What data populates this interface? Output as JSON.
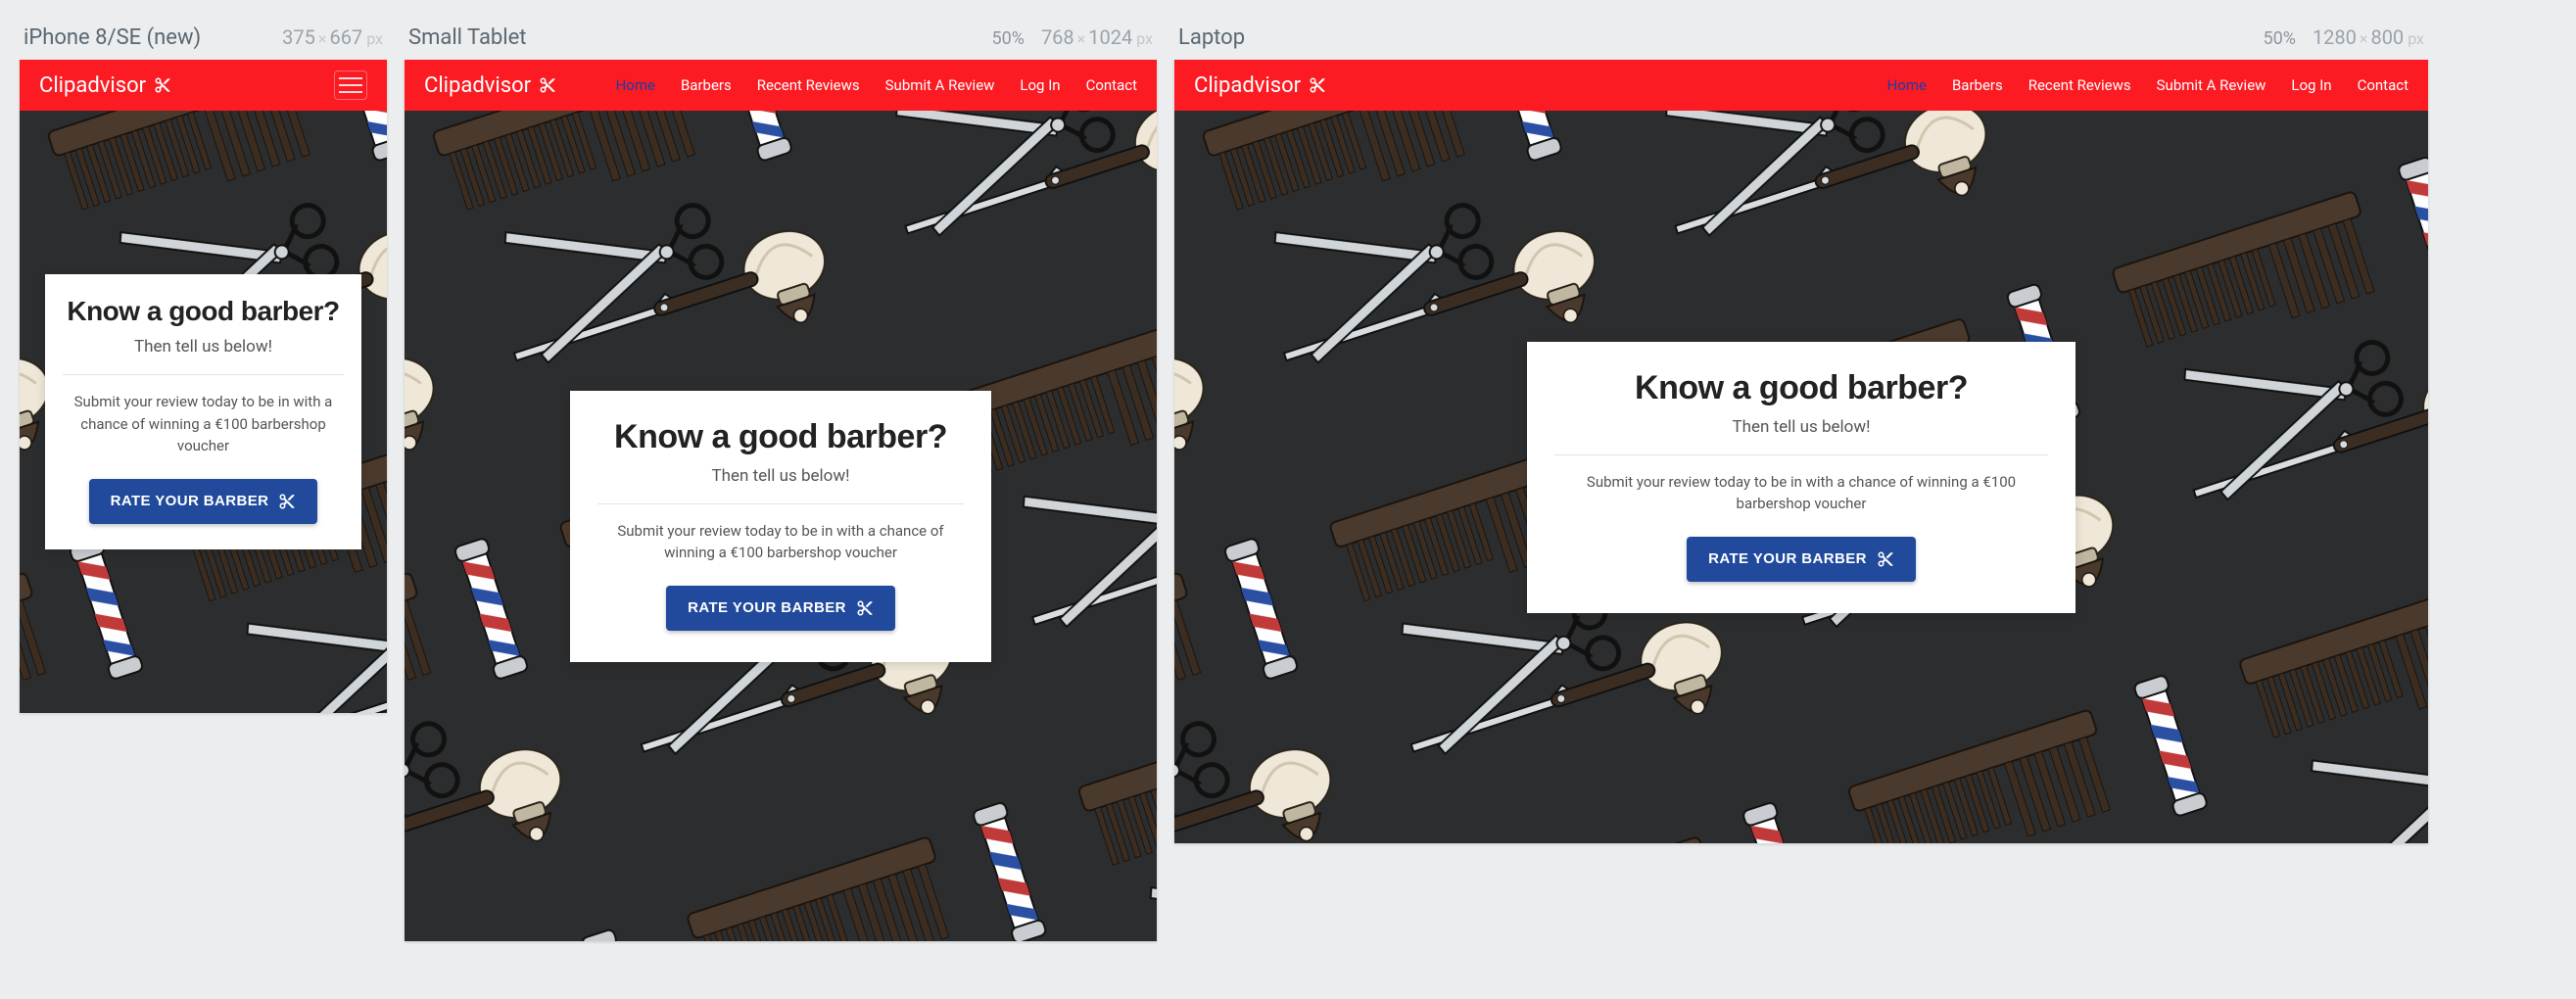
{
  "frames": {
    "mobile": {
      "label": "iPhone 8/SE (new)",
      "w": "375",
      "h": "667"
    },
    "tablet": {
      "label": "Small Tablet",
      "pct": "50%",
      "w": "768",
      "h": "1024"
    },
    "laptop": {
      "label": "Laptop",
      "pct": "50%",
      "w": "1280",
      "h": "800"
    }
  },
  "brand": "Clipadvisor",
  "nav": {
    "home": "Home",
    "barbers": "Barbers",
    "recent": "Recent Reviews",
    "submit": "Submit A Review",
    "login": "Log In",
    "contact": "Contact"
  },
  "hero": {
    "title": "Know a good barber?",
    "subtitle": "Then tell us below!",
    "promo": "Submit your review today to be in with a chance of winning a €100 barbershop voucher",
    "cta": "RATE YOUR BARBER"
  }
}
